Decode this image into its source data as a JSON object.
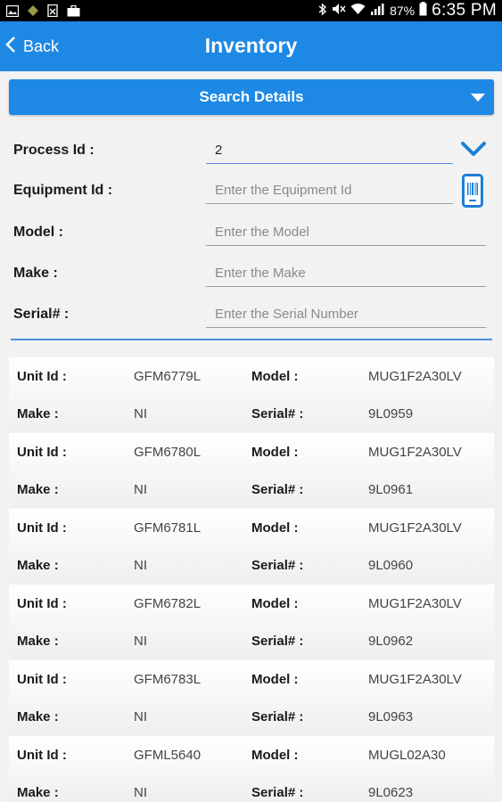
{
  "status_bar": {
    "battery": "87%",
    "time": "6:35 PM"
  },
  "header": {
    "back_label": "Back",
    "title": "Inventory"
  },
  "search_bar": {
    "label": "Search Details"
  },
  "form": {
    "process_id": {
      "label": "Process Id :",
      "value": "2"
    },
    "equipment_id": {
      "label": "Equipment Id :",
      "placeholder": "Enter the Equipment Id"
    },
    "model": {
      "label": "Model :",
      "placeholder": "Enter the Model"
    },
    "make": {
      "label": "Make :",
      "placeholder": "Enter the Make"
    },
    "serial": {
      "label": "Serial# :",
      "placeholder": "Enter the Serial Number"
    }
  },
  "field_labels": {
    "unit_id": "Unit Id :",
    "model": "Model :",
    "make": "Make :",
    "serial": "Serial# :"
  },
  "items": [
    {
      "unit_id": "GFM6779L",
      "model": "MUG1F2A30LV",
      "make": "NI",
      "serial": "9L0959"
    },
    {
      "unit_id": "GFM6780L",
      "model": "MUG1F2A30LV",
      "make": "NI",
      "serial": "9L0961"
    },
    {
      "unit_id": "GFM6781L",
      "model": "MUG1F2A30LV",
      "make": "NI",
      "serial": "9L0960"
    },
    {
      "unit_id": "GFM6782L",
      "model": "MUG1F2A30LV",
      "make": "NI",
      "serial": "9L0962"
    },
    {
      "unit_id": "GFM6783L",
      "model": "MUG1F2A30LV",
      "make": "NI",
      "serial": "9L0963"
    },
    {
      "unit_id": "GFML5640",
      "model": "MUGL02A30",
      "make": "NI",
      "serial": "9L0623"
    }
  ],
  "colors": {
    "primary": "#1e88e5",
    "accent_icon": "#1e7ed6"
  }
}
